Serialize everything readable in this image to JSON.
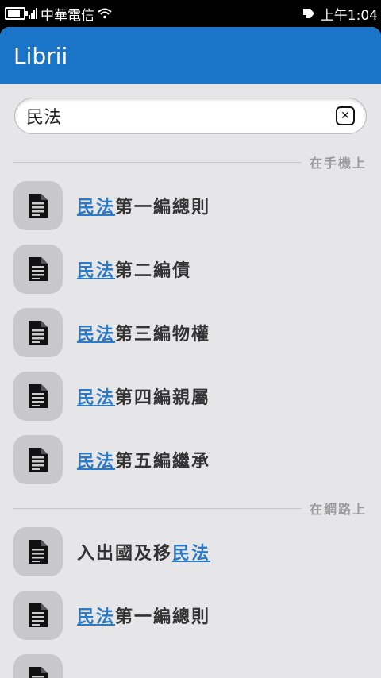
{
  "status_bar": {
    "carrier": "中華電信",
    "time": "上午1:04"
  },
  "app": {
    "title": "Librii"
  },
  "search": {
    "query": "民法"
  },
  "sections": [
    {
      "label": "在手機上",
      "results": [
        {
          "highlight": "民法",
          "pre": "",
          "post": "第一編總則"
        },
        {
          "highlight": "民法",
          "pre": "",
          "post": "第二編債"
        },
        {
          "highlight": "民法",
          "pre": "",
          "post": "第三編物權"
        },
        {
          "highlight": "民法",
          "pre": "",
          "post": "第四編親屬"
        },
        {
          "highlight": "民法",
          "pre": "",
          "post": "第五編繼承"
        }
      ]
    },
    {
      "label": "在網路上",
      "results": [
        {
          "highlight": "民法",
          "pre": "入出國及移",
          "post": ""
        },
        {
          "highlight": "民法",
          "pre": "",
          "post": "第一編總則"
        },
        {
          "highlight": "",
          "pre": "",
          "post": ""
        }
      ]
    }
  ]
}
